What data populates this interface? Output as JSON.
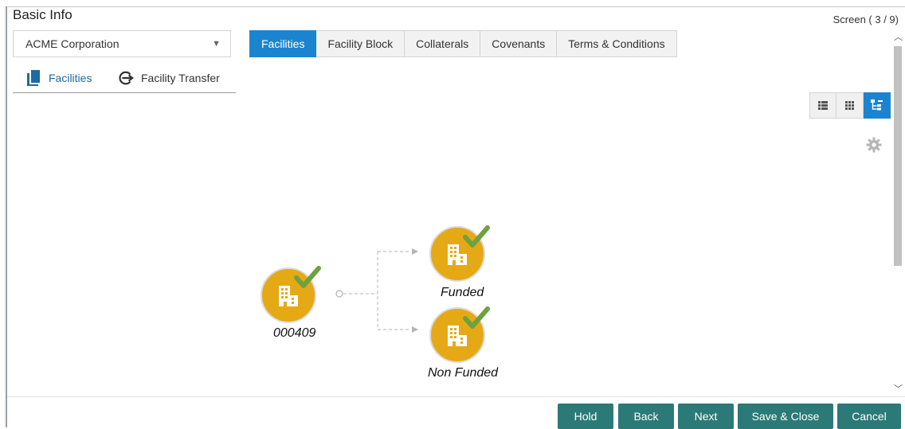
{
  "header": {
    "title": "Basic Info",
    "screen_counter": "Screen ( 3 / 9)"
  },
  "customer_select": {
    "value": "ACME Corporation"
  },
  "tabs": [
    {
      "label": "Facilities",
      "active": true
    },
    {
      "label": "Facility Block",
      "active": false
    },
    {
      "label": "Collaterals",
      "active": false
    },
    {
      "label": "Covenants",
      "active": false
    },
    {
      "label": "Terms & Conditions",
      "active": false
    }
  ],
  "subtabs": [
    {
      "label": "Facilities",
      "icon": "document-icon",
      "active": true
    },
    {
      "label": "Facility Transfer",
      "icon": "transfer-icon",
      "active": false
    }
  ],
  "view_toggle": {
    "options": [
      "list-view-icon",
      "grid-view-icon",
      "tree-view-icon"
    ],
    "active": "tree-view-icon"
  },
  "tree": {
    "root": {
      "label": "000409",
      "status": "approved"
    },
    "children": [
      {
        "label": "Funded",
        "status": "approved"
      },
      {
        "label": "Non Funded",
        "status": "approved"
      }
    ]
  },
  "colors": {
    "accent": "#1b84d0",
    "node": "#e6a916",
    "check": "#6ea13f",
    "footer_button": "#2b7a78"
  },
  "footer": {
    "hold": "Hold",
    "back": "Back",
    "next": "Next",
    "save_close": "Save & Close",
    "cancel": "Cancel"
  }
}
